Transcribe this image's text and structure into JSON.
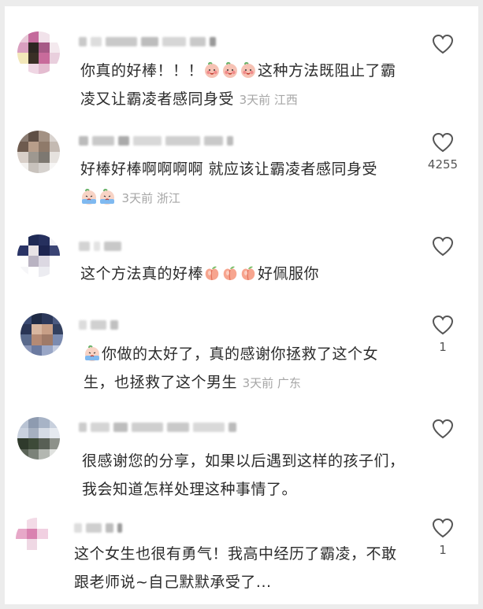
{
  "comments": [
    {
      "segments": [
        {
          "t": "text",
          "v": "你真的好棒！！！"
        },
        {
          "t": "emoji",
          "v": "peach-face"
        },
        {
          "t": "emoji",
          "v": "peach-face"
        },
        {
          "t": "emoji",
          "v": "peach-face"
        },
        {
          "t": "text",
          "v": "这种方法既阻止了霸凌又让霸凌者感同身受"
        }
      ],
      "time": "3天前",
      "location": "江西",
      "likes": ""
    },
    {
      "segments": [
        {
          "t": "text",
          "v": "好棒好棒啊啊啊啊 就应该让霸凌者感同身受"
        },
        {
          "t": "emoji",
          "v": "crying-face"
        },
        {
          "t": "emoji",
          "v": "crying-face"
        }
      ],
      "time": "3天前",
      "location": "浙江",
      "likes": "4255"
    },
    {
      "segments": [
        {
          "t": "text",
          "v": "这个方法真的好棒"
        },
        {
          "t": "emoji",
          "v": "peach"
        },
        {
          "t": "emoji",
          "v": "peach"
        },
        {
          "t": "emoji",
          "v": "peach"
        },
        {
          "t": "text",
          "v": "好佩服你"
        }
      ],
      "time": "",
      "location": "",
      "likes": ""
    },
    {
      "segments": [
        {
          "t": "emoji",
          "v": "crying-face"
        },
        {
          "t": "text",
          "v": "你做的太好了，真的感谢你拯救了这个女生，也拯救了这个男生"
        }
      ],
      "time": "3天前",
      "location": "广东",
      "likes": "1"
    },
    {
      "segments": [
        {
          "t": "text",
          "v": "很感谢您的分享，如果以后遇到这样的孩子们，我会知道怎样处理这种事情了。"
        }
      ],
      "time": "",
      "location": "",
      "likes": ""
    },
    {
      "segments": [
        {
          "t": "text",
          "v": "这个女生也很有勇气！我高中经历了霸凌，不敢跟老师说~自己默默承受了..."
        }
      ],
      "time": "",
      "location": "",
      "likes": "1"
    }
  ],
  "colors": {
    "text": "#2b2b2b",
    "meta": "#a6a6a6",
    "heart_stroke": "#555555",
    "background": "#ffffff"
  }
}
